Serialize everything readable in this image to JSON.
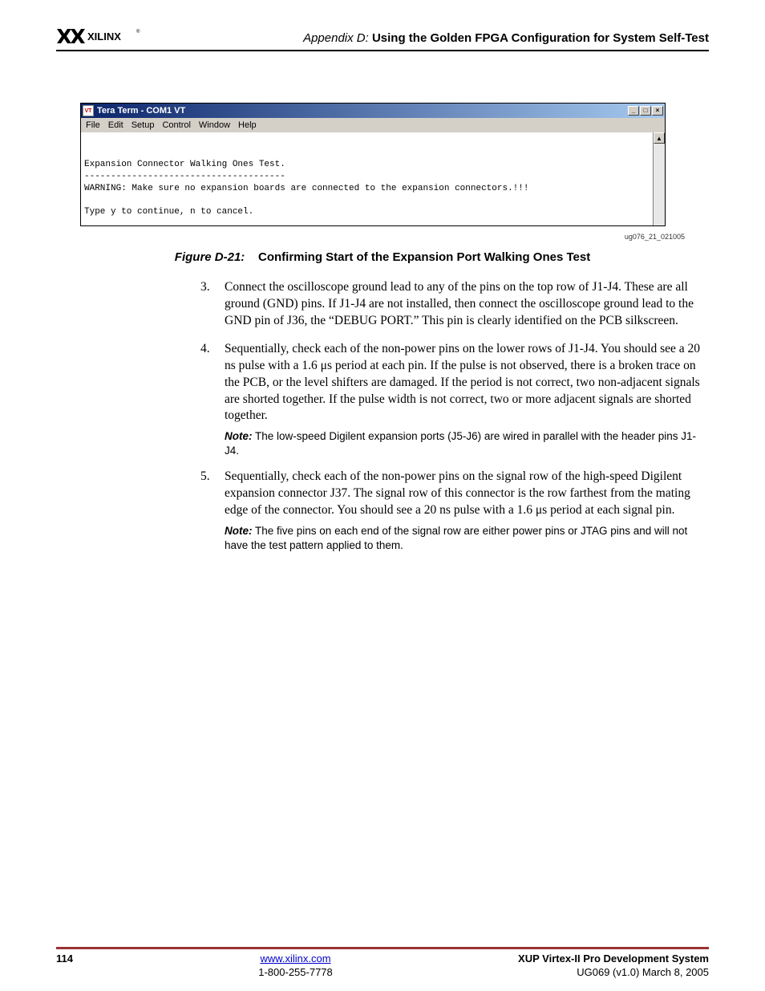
{
  "header": {
    "appendix_label": "Appendix D:",
    "appendix_title": "Using the Golden FPGA Configuration for System Self-Test"
  },
  "window": {
    "title": "Tera Term - COM1 VT",
    "icon_text": "VT",
    "menu": [
      "File",
      "Edit",
      "Setup",
      "Control",
      "Window",
      "Help"
    ],
    "buttons": {
      "minimize": "_",
      "maximize": "□",
      "close": "×"
    },
    "scroll_up": "▲",
    "terminal_lines": "\nExpansion Connector Walking Ones Test.\n--------------------------------------\nWARNING: Make sure no expansion boards are connected to the expansion connectors.!!!\n\nType y to continue, n to cancel."
  },
  "figure_asset_id": "ug076_21_021005",
  "figure_caption": {
    "label": "Figure D-21:",
    "title": "Confirming Start of the Expansion Port Walking Ones Test"
  },
  "items": [
    {
      "num": "3.",
      "text": "Connect the oscilloscope ground lead to any of the pins on the top row of J1-J4. These are all ground (GND) pins. If J1-J4 are not installed, then connect the oscilloscope ground lead to the GND pin of J36, the “DEBUG PORT.” This pin is clearly identified on the PCB silkscreen."
    },
    {
      "num": "4.",
      "text": "Sequentially, check each of the non-power pins on the lower rows of J1-J4. You should see a 20 ns pulse with a 1.6 μs period at each pin. If the pulse is not observed, there is a broken trace on the PCB, or the level shifters are damaged. If the period is not correct, two non-adjacent signals are shorted together. If the pulse width is not correct, two or more adjacent signals are shorted together.",
      "note": "The low-speed Digilent expansion ports (J5-J6) are wired in parallel with the header pins J1-J4."
    },
    {
      "num": "5.",
      "text": "Sequentially, check each of the non-power pins on the signal row of the high-speed Digilent expansion connector J37. The signal row of this connector is the row farthest from the mating edge of the connector. You should see a 20 ns pulse with a 1.6 μs period at each signal pin.",
      "note": "The five pins on each end of the signal row are either power pins or JTAG pins and will not have the test pattern applied to them."
    }
  ],
  "note_label": "Note:",
  "footer": {
    "page": "114",
    "link": "www.xilinx.com",
    "phone": "1-800-255-7778",
    "product": "XUP Virtex-II Pro Development System",
    "doc": "UG069 (v1.0) March 8, 2005"
  }
}
